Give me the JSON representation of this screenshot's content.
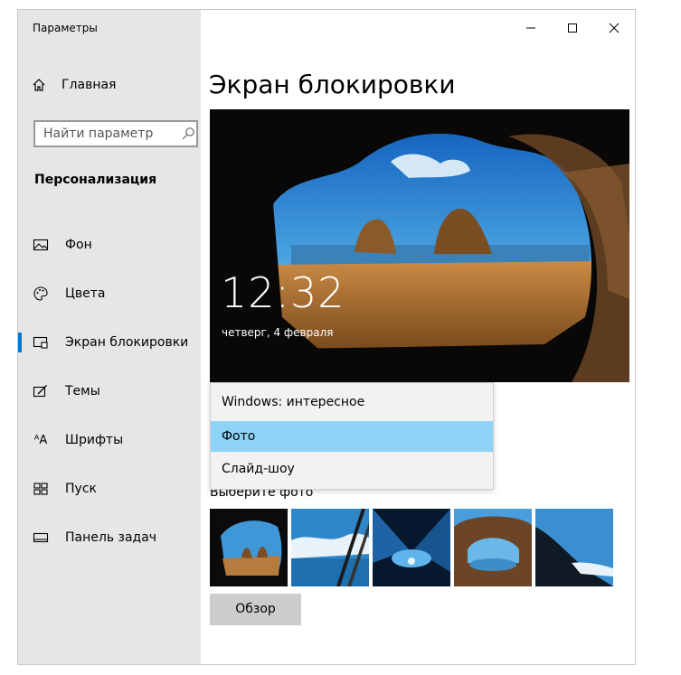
{
  "app": {
    "title": "Параметры"
  },
  "sidebar": {
    "home_label": "Главная",
    "search_placeholder": "Найти параметр",
    "section_title": "Персонализация",
    "items": [
      {
        "label": "Фон",
        "icon": "picture-icon"
      },
      {
        "label": "Цвета",
        "icon": "palette-icon"
      },
      {
        "label": "Экран блокировки",
        "icon": "lock-screen-icon",
        "active": true
      },
      {
        "label": "Темы",
        "icon": "themes-icon"
      },
      {
        "label": "Шрифты",
        "icon": "fonts-icon"
      },
      {
        "label": "Пуск",
        "icon": "start-icon"
      },
      {
        "label": "Панель задач",
        "icon": "taskbar-icon"
      }
    ]
  },
  "titlebar": {
    "minimize": "–",
    "maximize": "☐",
    "close": "✕"
  },
  "main": {
    "title": "Экран блокировки",
    "preview": {
      "time": "12:32",
      "date": "четверг, 4 февраля"
    },
    "background_options": [
      {
        "label": "Windows: интересное"
      },
      {
        "label": "Фото",
        "selected": true
      },
      {
        "label": "Слайд-шоу"
      }
    ],
    "choose_photo_label": "Выберите фото",
    "browse_button": "Обзор",
    "fonts_icon_text": "ᴬA"
  },
  "colors": {
    "accent": "#0078d7",
    "selected_option": "#8dd3f5",
    "sidebar_bg": "#e6e6e6"
  }
}
